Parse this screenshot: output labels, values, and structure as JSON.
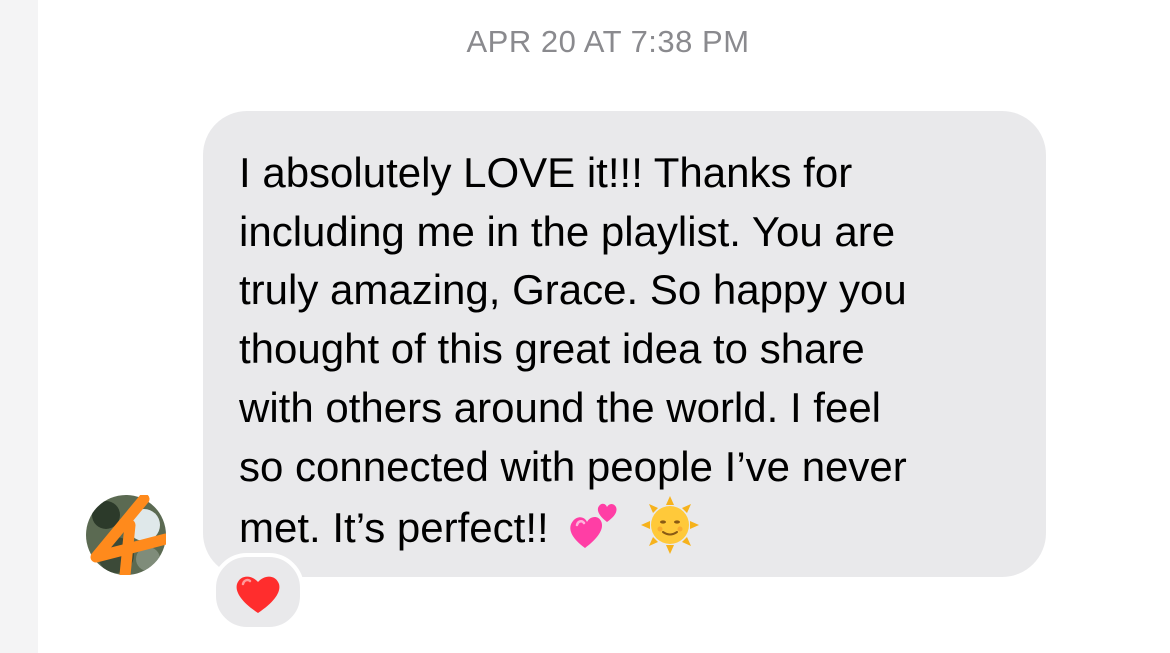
{
  "conversation": {
    "timestamp": "APR 20 AT 7:38 PM"
  },
  "message": {
    "text": "I absolutely LOVE it!!! Thanks for\nincluding me in the playlist. You are\ntruly amazing, Grace. So happy you\nthought of this great idea to share\nwith others around the world. I feel\nso connected with people I’ve never\nmet. It’s perfect!!",
    "emojis": [
      "two-hearts",
      "sun-with-face"
    ],
    "bubble_color": "#e9e9eb",
    "text_color": "#000000"
  },
  "reaction": {
    "icon": "red-heart",
    "color": "#ff2d2d"
  },
  "avatar": {
    "scribble_color": "#ff8a1c"
  },
  "colors": {
    "timestamp": "#8a8a8e",
    "background": "#ffffff"
  }
}
